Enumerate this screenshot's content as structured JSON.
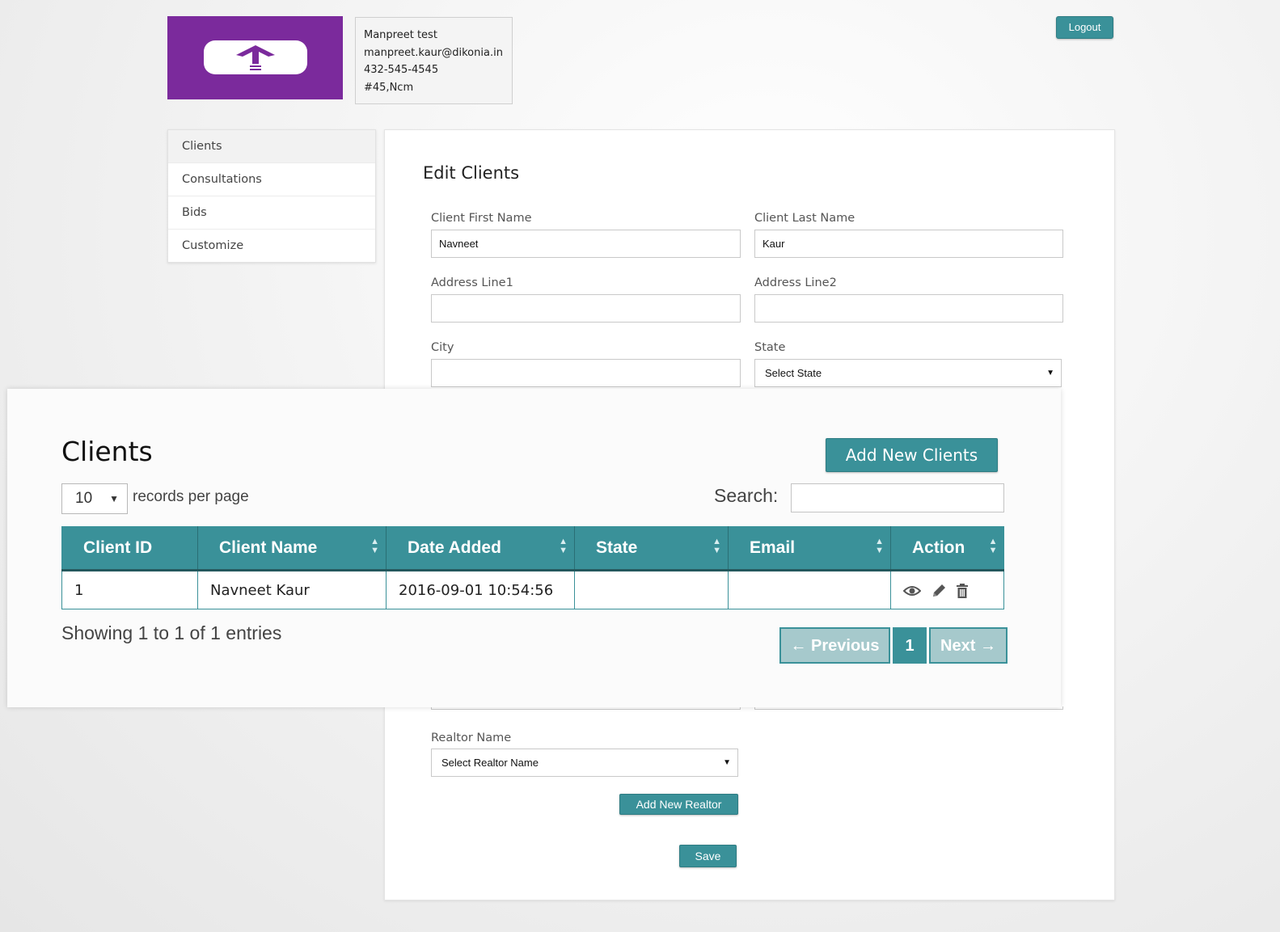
{
  "header": {
    "logo_icon": "upload-arrow-icon",
    "profile": {
      "name": "Manpreet test",
      "email": "manpreet.kaur@dikonia.in",
      "phone": "432-545-4545",
      "address": "#45,Ncm"
    },
    "logout_label": "Logout"
  },
  "sidebar": {
    "items": [
      {
        "label": "Clients"
      },
      {
        "label": "Consultations"
      },
      {
        "label": "Bids"
      },
      {
        "label": "Customize"
      }
    ]
  },
  "edit_form": {
    "title": "Edit Clients",
    "first_name": {
      "label": "Client First Name",
      "value": "Navneet"
    },
    "last_name": {
      "label": "Client Last Name",
      "value": "Kaur"
    },
    "address1": {
      "label": "Address Line1",
      "value": ""
    },
    "address2": {
      "label": "Address Line2",
      "value": ""
    },
    "city": {
      "label": "City",
      "value": ""
    },
    "state": {
      "label": "State",
      "selected": "Select State"
    },
    "realtor": {
      "label": "Realtor Name",
      "selected": "Select Realtor Name"
    },
    "add_realtor_label": "Add New Realtor",
    "save_label": "Save"
  },
  "clients_table": {
    "title": "Clients",
    "add_button_label": "Add New Clients",
    "per_page_value": "10",
    "per_page_label": "records per page",
    "search_label": "Search:",
    "search_value": "",
    "columns": [
      "Client ID",
      "Client Name",
      "Date Added",
      "State",
      "Email",
      "Action"
    ],
    "rows": [
      {
        "id": "1",
        "name": "Navneet Kaur",
        "date_added": "2016-09-01 10:54:56",
        "state": "",
        "email": "",
        "actions": [
          "view-eye-icon",
          "edit-pencil-icon",
          "delete-trash-icon"
        ]
      }
    ],
    "info": "Showing 1 to 1 of 1 entries",
    "pager": {
      "previous": "← Previous",
      "current": "1",
      "next": "Next →"
    }
  },
  "colors": {
    "accent": "#3a9199",
    "logo_bg": "#7b2a9c"
  }
}
